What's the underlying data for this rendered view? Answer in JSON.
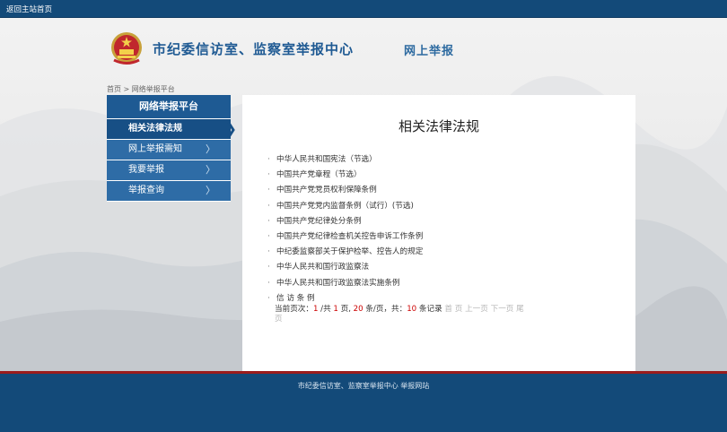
{
  "topbar": {
    "home_link": "返回主站首页"
  },
  "header": {
    "title": "市纪委信访室、监察室举报中心",
    "subtitle": "网上举报"
  },
  "breadcrumb": {
    "home": "首页",
    "separator": ">",
    "current": "网络举报平台"
  },
  "sidebar": {
    "title": "网络举报平台",
    "items": [
      {
        "label": "相关法律法规",
        "active": true
      },
      {
        "label": "网上举报需知"
      },
      {
        "label": "我要举报"
      },
      {
        "label": "举报查询"
      }
    ]
  },
  "main": {
    "title": "相关法律法规",
    "laws": [
      "中华人民共和国宪法（节选）",
      "中国共产党章程（节选）",
      "中国共产党党员权利保障条例",
      "中国共产党党内监督条例（试行）(节选)",
      "中国共产党纪律处分条例",
      "中国共产党纪律检查机关控告申诉工作条例",
      "中纪委监察部关于保护检举、控告人的规定",
      "中华人民共和国行政监察法",
      "中华人民共和国行政监察法实施条例",
      "信 访 条 例"
    ],
    "pager": {
      "prefix": "当前页次：",
      "current_page": "1",
      "total_prefix": " /共 ",
      "total_pages": "1",
      "page_unit": " 页, ",
      "per_page": "20",
      "per_page_unit": " 条/页，共：",
      "total_records": "10",
      "records_unit": " 条记录 ",
      "first": "首 页",
      "prev": "上一页",
      "next": "下一页",
      "last": "尾 页"
    }
  },
  "footer": {
    "copyright": "市纪委信访室、监察室举报中心 举报网站"
  },
  "colors": {
    "primary_blue": "#134a79",
    "nav_blue": "#2e6ca6",
    "active_blue": "#174f85",
    "accent_red": "#9b1c1c"
  }
}
